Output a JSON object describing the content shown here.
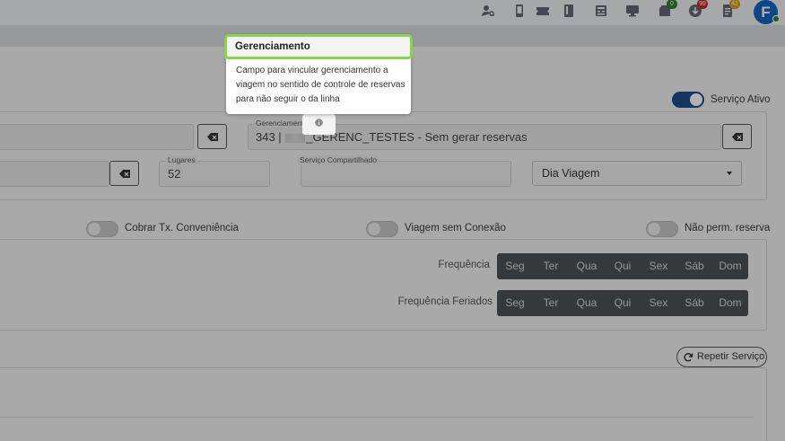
{
  "topbar": {
    "icons": [
      {
        "name": "user-key-icon"
      },
      {
        "name": "phone-icon"
      },
      {
        "name": "ticket-icon"
      },
      {
        "name": "book-icon"
      },
      {
        "name": "register-icon"
      },
      {
        "name": "monitor-icon"
      },
      {
        "name": "tray-icon",
        "badge": "0",
        "badge_color": "#2e7d32"
      },
      {
        "name": "download-icon",
        "badge": "99",
        "badge_color": "#c62828"
      },
      {
        "name": "document-icon",
        "badge": "41",
        "badge_color": "#d4a017"
      }
    ],
    "avatar_letter": "F"
  },
  "toggles": {
    "servico_ativo": {
      "label": "Serviço Ativo",
      "on": true
    },
    "cobrar_tx": {
      "label": "Cobrar Tx. Conveniência",
      "on": false
    },
    "viagem_sem_conexao": {
      "label": "Viagem sem Conexão",
      "on": false
    },
    "nao_perm_reserva": {
      "label": "Não perm. reserva",
      "on": false
    }
  },
  "form": {
    "gerenciamento": {
      "label": "Gerenciamento",
      "value_prefix": "343 |",
      "value_suffix": "_GERENC_TESTES - Sem gerar reservas"
    },
    "lugares": {
      "label": "Lugares",
      "value": "52"
    },
    "servico_compartilhado": {
      "label": "Serviço Compartilhado",
      "value": ""
    },
    "tipo_data": {
      "selected": "Dia Viagem"
    }
  },
  "frequencia": {
    "label": "Frequência",
    "days": [
      "Seg",
      "Ter",
      "Qua",
      "Qui",
      "Sex",
      "Sáb",
      "Dom"
    ]
  },
  "frequencia_feriados": {
    "label": "Frequência Feriados",
    "days": [
      "Seg",
      "Ter",
      "Qua",
      "Qui",
      "Sex",
      "Sáb",
      "Dom"
    ]
  },
  "repeat_button": {
    "label": "Repetir Serviço"
  },
  "tooltip": {
    "title": "Gerenciamento",
    "body": "Campo para vincular gerenciamento a viagem no sentido de controle de reservas para não seguir o da linha"
  },
  "colors": {
    "accent": "#1f4e8c",
    "tooltip_border": "#8fd14f",
    "day_button_bg": "#4d5256"
  }
}
